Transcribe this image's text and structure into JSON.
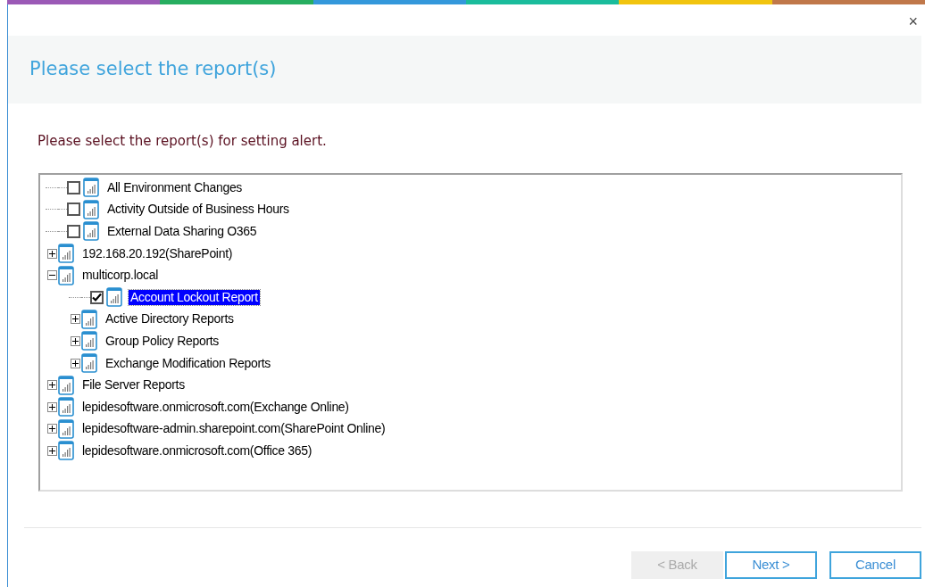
{
  "accent_stripe": [
    {
      "color": "#9b59b6"
    },
    {
      "color": "#27ae60"
    },
    {
      "color": "#3498db"
    },
    {
      "color": "#1abc9c"
    },
    {
      "color": "#f1c40f"
    },
    {
      "color": "#c0784a"
    }
  ],
  "close": "×",
  "header": {
    "title": "Please select the report(s)"
  },
  "instruction": "Please select the report(s) for setting alert.",
  "tree": [
    {
      "label": "All Environment Changes",
      "checked": false,
      "selected": false
    },
    {
      "label": "Activity Outside of Business Hours",
      "checked": false,
      "selected": false
    },
    {
      "label": "External Data Sharing O365",
      "checked": false,
      "selected": false
    },
    {
      "label": "192.168.20.192(SharePoint)",
      "expanded": false,
      "selected": false
    },
    {
      "label": "multicorp.local",
      "expanded": true,
      "selected": false,
      "children": [
        {
          "label": "Account Lockout Report",
          "checked": true,
          "selected": true
        },
        {
          "label": "Active Directory Reports",
          "expanded": false,
          "selected": false
        },
        {
          "label": "Group Policy Reports",
          "expanded": false,
          "selected": false
        },
        {
          "label": "Exchange Modification Reports",
          "expanded": false,
          "selected": false
        }
      ]
    },
    {
      "label": "File Server Reports",
      "expanded": false,
      "selected": false
    },
    {
      "label": "lepidesoftware.onmicrosoft.com(Exchange Online)",
      "expanded": false,
      "selected": false
    },
    {
      "label": "lepidesoftware-admin.sharepoint.com(SharePoint Online)",
      "expanded": false,
      "selected": false
    },
    {
      "label": "lepidesoftware.onmicrosoft.com(Office 365)",
      "expanded": false,
      "selected": false
    }
  ],
  "buttons": [
    {
      "label": "< Back",
      "disabled": true
    },
    {
      "label": "Next >",
      "disabled": false
    },
    {
      "label": "Cancel",
      "disabled": false
    }
  ]
}
